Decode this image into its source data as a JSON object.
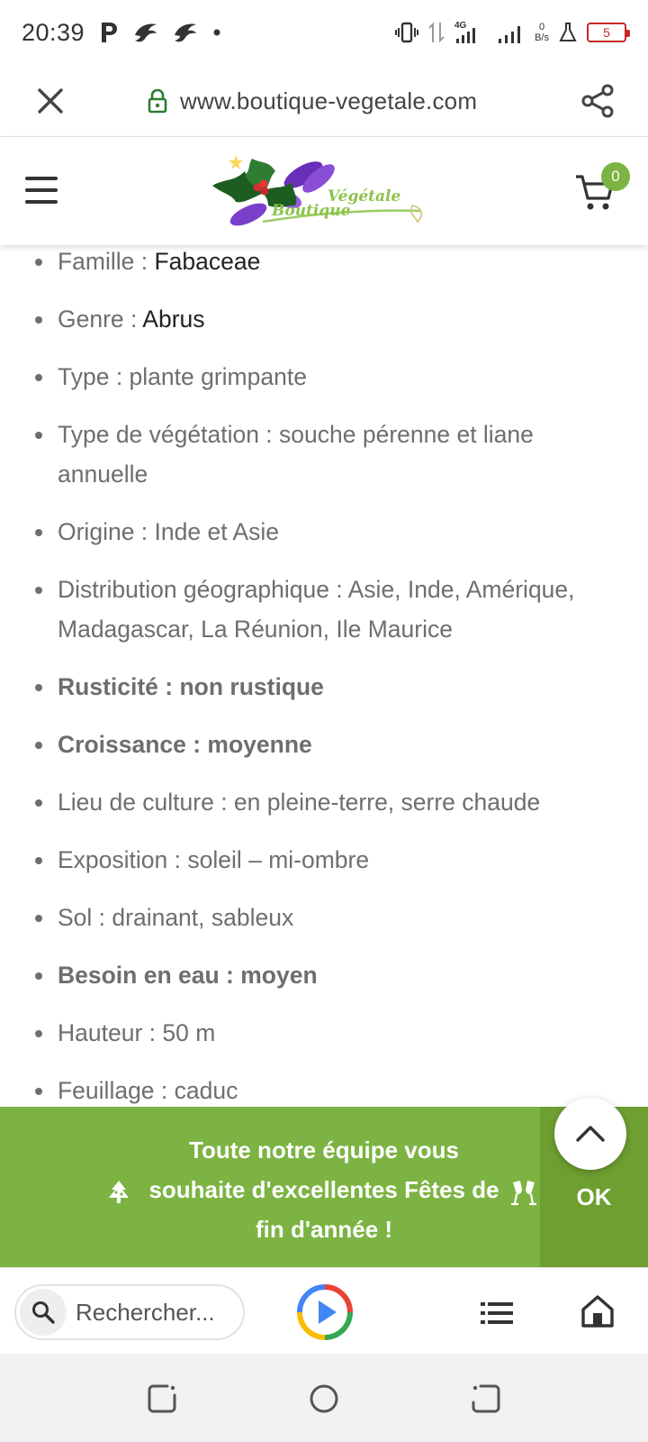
{
  "status_bar": {
    "time": "20:39",
    "network": "4G",
    "speed_value": "0",
    "speed_unit": "B/s",
    "battery": "5"
  },
  "url_bar": {
    "url": "www.boutique-vegetale.com"
  },
  "header": {
    "logo_text_1": "Boutique",
    "logo_text_2": "Végétale",
    "cart_count": "0"
  },
  "content": {
    "items": [
      {
        "label": "Famille : ",
        "value": "Fabaceae"
      },
      {
        "label": "Genre : ",
        "value": "Abrus"
      },
      {
        "label": "Type : plante grimpante"
      },
      {
        "label": "Type de végétation : souche pérenne et liane annuelle"
      },
      {
        "label": "Origine : Inde et Asie"
      },
      {
        "label": "Distribution géographique : Asie, Inde, Amérique, Madagascar, La Réunion, Ile Maurice"
      },
      {
        "label": "Rusticité : non rustique"
      },
      {
        "label": "Croissance : moyenne"
      },
      {
        "label": "Lieu de culture : en pleine-terre, serre chaude"
      },
      {
        "label": "Exposition : soleil – mi-ombre"
      },
      {
        "label": "Sol : drainant, sableux"
      },
      {
        "label": "Besoin en eau : moyen"
      },
      {
        "label": "Hauteur : 50 m"
      },
      {
        "label": "Feuillage : caduc"
      }
    ]
  },
  "banner": {
    "line1": "Toute notre équipe vous",
    "line2": "souhaite d'excellentes Fêtes de",
    "line3": "fin d'année !",
    "ok_label": "OK"
  },
  "bottom_bar": {
    "search_placeholder": "Rechercher..."
  },
  "colors": {
    "accent_green": "#7cb342",
    "ok_green": "#6e9f30",
    "lock_green": "#2e7d32",
    "battery_red": "#c62828"
  }
}
